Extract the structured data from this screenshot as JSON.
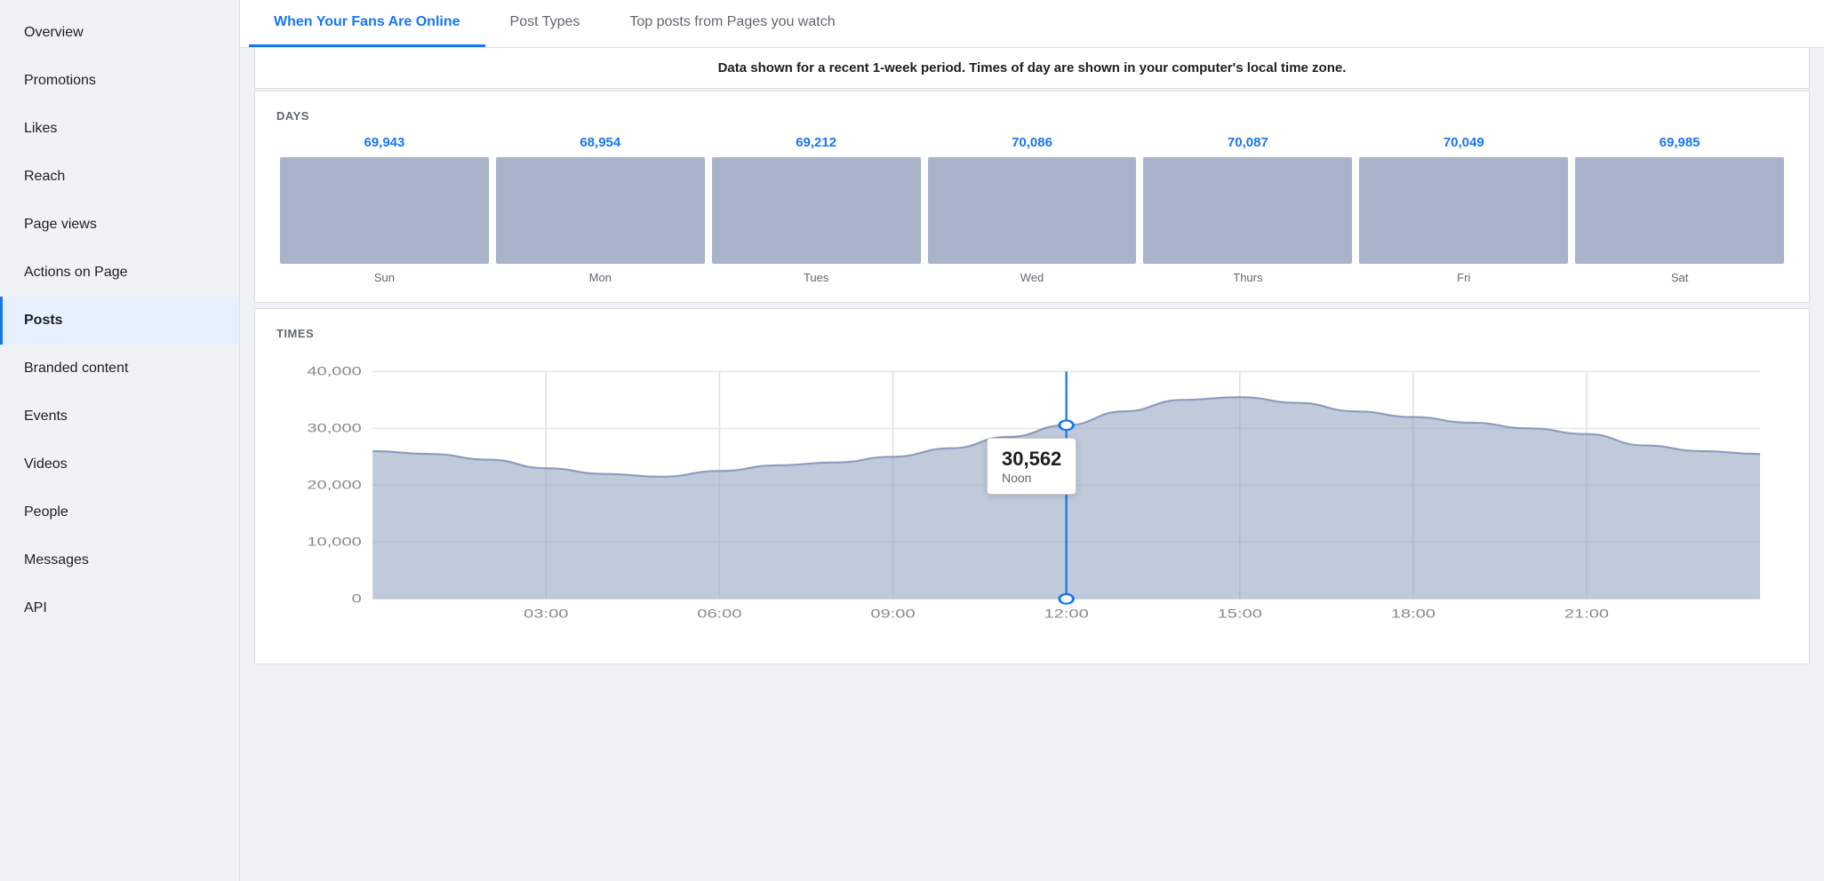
{
  "sidebar": {
    "items": [
      {
        "label": "Overview",
        "id": "overview",
        "active": false
      },
      {
        "label": "Promotions",
        "id": "promotions",
        "active": false
      },
      {
        "label": "Likes",
        "id": "likes",
        "active": false
      },
      {
        "label": "Reach",
        "id": "reach",
        "active": false
      },
      {
        "label": "Page views",
        "id": "page-views",
        "active": false
      },
      {
        "label": "Actions on Page",
        "id": "actions-on-page",
        "active": false
      },
      {
        "label": "Posts",
        "id": "posts",
        "active": true
      },
      {
        "label": "Branded content",
        "id": "branded-content",
        "active": false
      },
      {
        "label": "Events",
        "id": "events",
        "active": false
      },
      {
        "label": "Videos",
        "id": "videos",
        "active": false
      },
      {
        "label": "People",
        "id": "people",
        "active": false
      },
      {
        "label": "Messages",
        "id": "messages",
        "active": false
      },
      {
        "label": "API",
        "id": "api",
        "active": false
      }
    ]
  },
  "tabs": [
    {
      "label": "When Your Fans Are Online",
      "active": true
    },
    {
      "label": "Post Types",
      "active": false
    },
    {
      "label": "Top posts from Pages you watch",
      "active": false
    }
  ],
  "info_bar_text": "Data shown for a recent 1-week period. Times of day are shown in your computer's local time zone.",
  "days_section": {
    "label": "DAYS",
    "days": [
      {
        "name": "Sun",
        "value": "69,943"
      },
      {
        "name": "Mon",
        "value": "68,954"
      },
      {
        "name": "Tues",
        "value": "69,212"
      },
      {
        "name": "Wed",
        "value": "70,086"
      },
      {
        "name": "Thurs",
        "value": "70,087"
      },
      {
        "name": "Fri",
        "value": "70,049"
      },
      {
        "name": "Sat",
        "value": "69,985"
      }
    ]
  },
  "times_section": {
    "label": "TIMES",
    "y_labels": [
      "40,000",
      "30,000",
      "20,000",
      "10,000",
      "0"
    ],
    "x_labels": [
      "03:00",
      "06:00",
      "09:00",
      "12:00",
      "15:00",
      "18:00",
      "21:00"
    ],
    "tooltip": {
      "value": "30,562",
      "label": "Noon"
    }
  }
}
